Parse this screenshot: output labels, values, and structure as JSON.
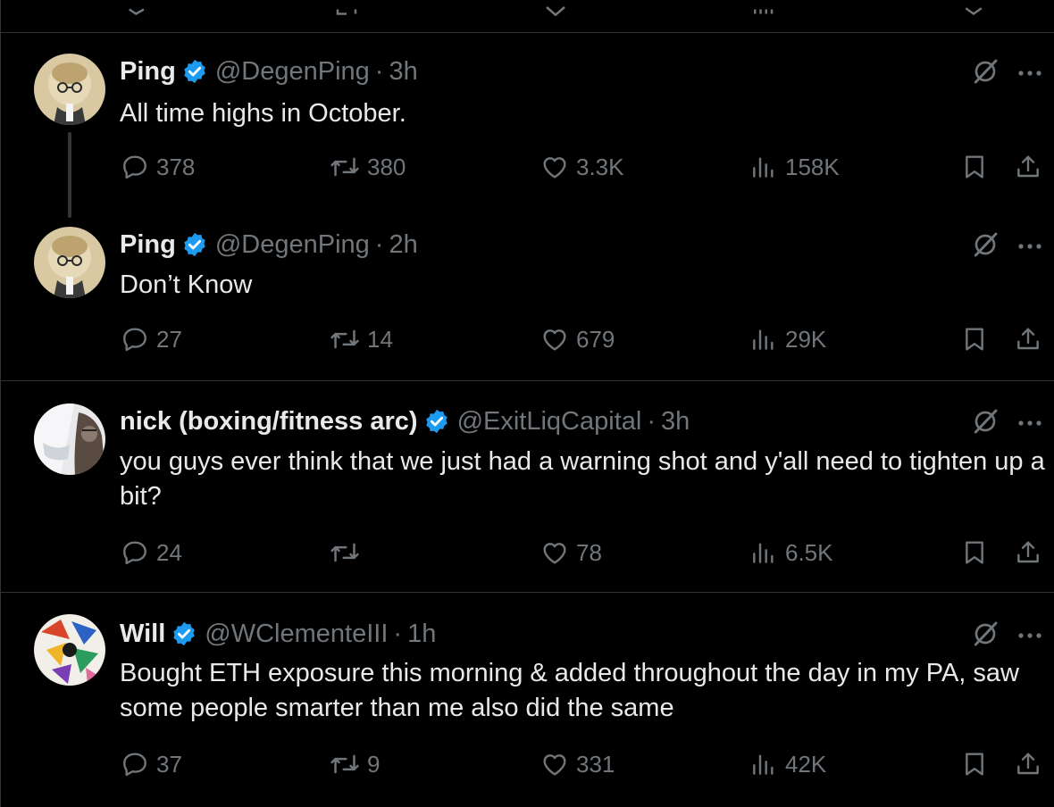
{
  "tweets": [
    {
      "name": "Ping",
      "handle": "@DegenPing",
      "sep": "·",
      "time": "3h",
      "text": "All time highs in October.",
      "stats": {
        "replies": "378",
        "retweets": "380",
        "likes": "3.3K",
        "views": "158K"
      }
    },
    {
      "name": "Ping",
      "handle": "@DegenPing",
      "sep": "·",
      "time": "2h",
      "text": "Don’t Know",
      "stats": {
        "replies": "27",
        "retweets": "14",
        "likes": "679",
        "views": "29K"
      }
    },
    {
      "name": "nick (boxing/fitness arc)",
      "handle": "@ExitLiqCapital",
      "sep": "·",
      "time": "3h",
      "text": "you guys ever think that we just had a warning shot and y'all need to tighten up a bit?",
      "stats": {
        "replies": "24",
        "retweets": "",
        "likes": "78",
        "views": "6.5K"
      }
    },
    {
      "name": "Will",
      "handle": "@WClementeIII",
      "sep": "·",
      "time": "1h",
      "text": "Bought ETH exposure this morning & added throughout the day in my PA, saw some people smarter than me also did the same",
      "stats": {
        "replies": "37",
        "retweets": "9",
        "likes": "331",
        "views": "42K"
      }
    }
  ],
  "colors": {
    "background": "#000000",
    "text": "#e7e9ea",
    "muted": "#71767b",
    "verified": "#1d9bf0",
    "border": "#2f3336"
  },
  "icons": [
    "reply-icon",
    "retweet-icon",
    "like-icon",
    "views-icon",
    "bookmark-icon",
    "share-icon",
    "grok-icon",
    "more-icon",
    "verified-icon"
  ]
}
